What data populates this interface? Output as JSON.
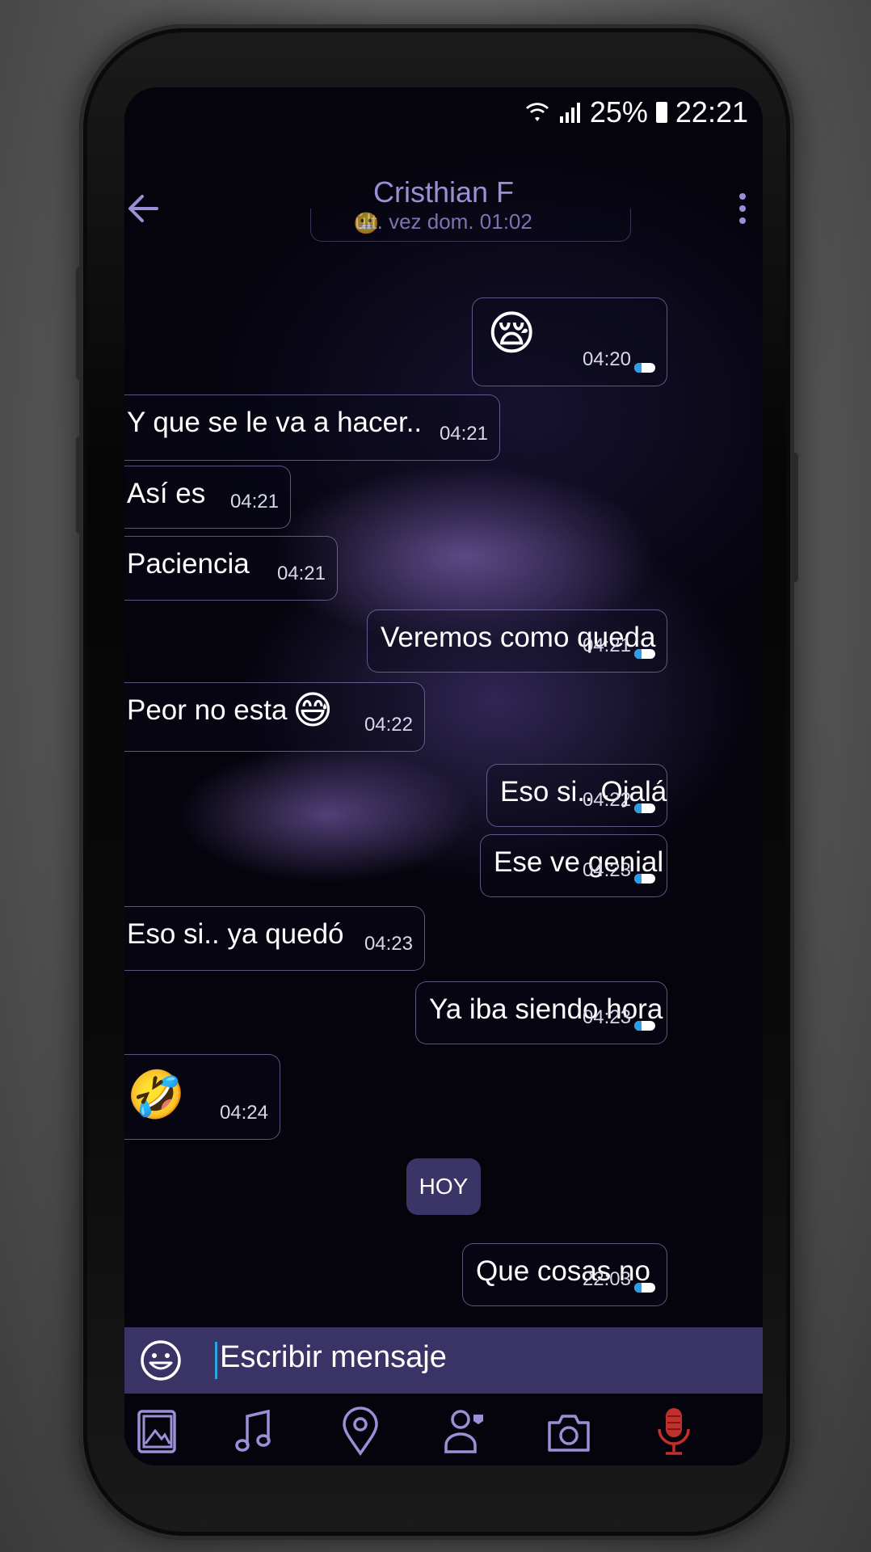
{
  "status_bar": {
    "battery": "25%",
    "time": "22:21"
  },
  "header": {
    "contact_name": "Cristhian F",
    "last_seen": "últ. vez dom. 01:02"
  },
  "messages": [
    {
      "text": "",
      "time": "04:20",
      "emoji": "😪",
      "direction": "out"
    },
    {
      "text": "Y que se le va a hacer..",
      "time": "04:21",
      "direction": "in"
    },
    {
      "text": "Así es",
      "time": "04:21",
      "direction": "in"
    },
    {
      "text": "Paciencia",
      "time": "04:21",
      "direction": "in"
    },
    {
      "text": "Veremos como queda",
      "time": "04:21",
      "direction": "out"
    },
    {
      "text": "Peor no esta",
      "time": "04:22",
      "emoji": "😅",
      "direction": "in"
    },
    {
      "text": "Eso si.. Ojalá",
      "time": "04:22",
      "direction": "out"
    },
    {
      "text": "Ese ve genial",
      "time": "04:23",
      "direction": "out"
    },
    {
      "text": "Eso si.. ya quedó",
      "time": "04:23",
      "direction": "in"
    },
    {
      "text": "Ya iba siendo hora",
      "time": "04:23",
      "direction": "out"
    },
    {
      "text": "",
      "time": "04:24",
      "emoji": "🤣",
      "direction": "in"
    },
    {
      "text": "Que cosas no",
      "time": "22:03",
      "direction": "out"
    }
  ],
  "day_divider": "HOY",
  "composer": {
    "placeholder": "Escribir mensaje"
  },
  "toolbar": [
    "gallery-icon",
    "music-icon",
    "location-icon",
    "contact-icon",
    "camera-icon",
    "microphone-icon"
  ],
  "colors": {
    "accent": "#9d8fd6",
    "composer_bg": "#3a3466",
    "mic": "#c2302b",
    "read_check": "#2b9fe6"
  }
}
